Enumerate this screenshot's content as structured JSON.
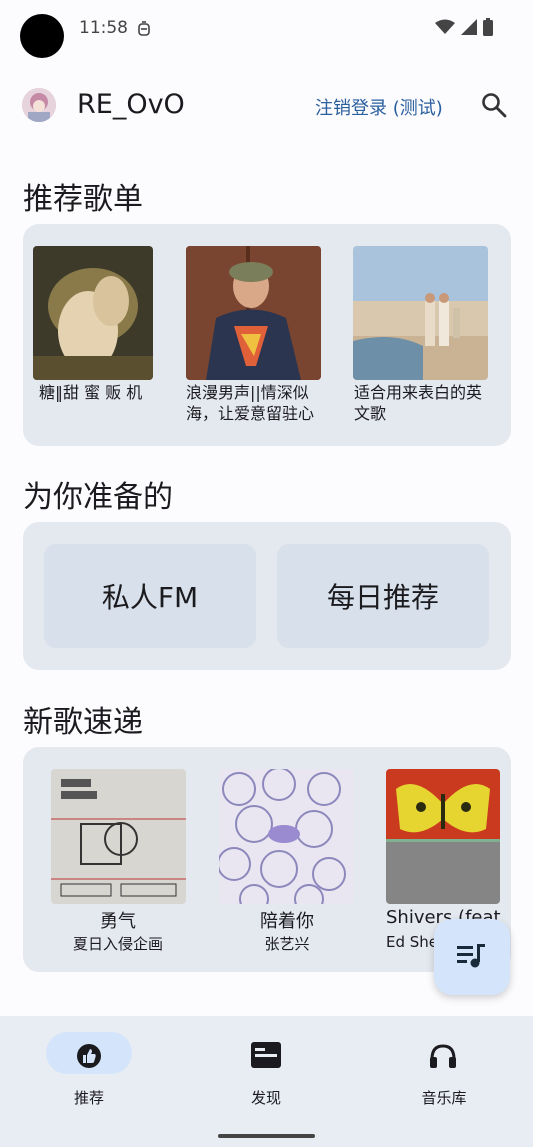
{
  "status_bar": {
    "time": "11:58"
  },
  "app_bar": {
    "title": "RE_OvO",
    "login_link": "注销登录 (测试)"
  },
  "recommended_playlists": {
    "title": "推荐歌单",
    "items": [
      {
        "label": "糖‖甜 蜜 贩 机"
      },
      {
        "label": "浪漫男声||情深似海，让爱意留驻心"
      },
      {
        "label": "适合用来表白的英文歌"
      }
    ]
  },
  "for_you": {
    "title": "为你准备的",
    "cards": [
      {
        "label": "私人FM"
      },
      {
        "label": "每日推荐"
      }
    ]
  },
  "new_songs": {
    "title": "新歌速递",
    "items": [
      {
        "name": "勇气",
        "artist": "夏日入侵企画"
      },
      {
        "name": "陪着你",
        "artist": "张艺兴"
      },
      {
        "name": "Shivers (feat",
        "artist": "Ed She"
      }
    ]
  },
  "bottom_nav": {
    "items": [
      {
        "label": "推荐"
      },
      {
        "label": "发现"
      },
      {
        "label": "音乐库"
      }
    ]
  },
  "colors": {
    "accent": "#2a5f9e",
    "card_bg": "#e4e8ef",
    "fab_bg": "#d3e4fb"
  }
}
